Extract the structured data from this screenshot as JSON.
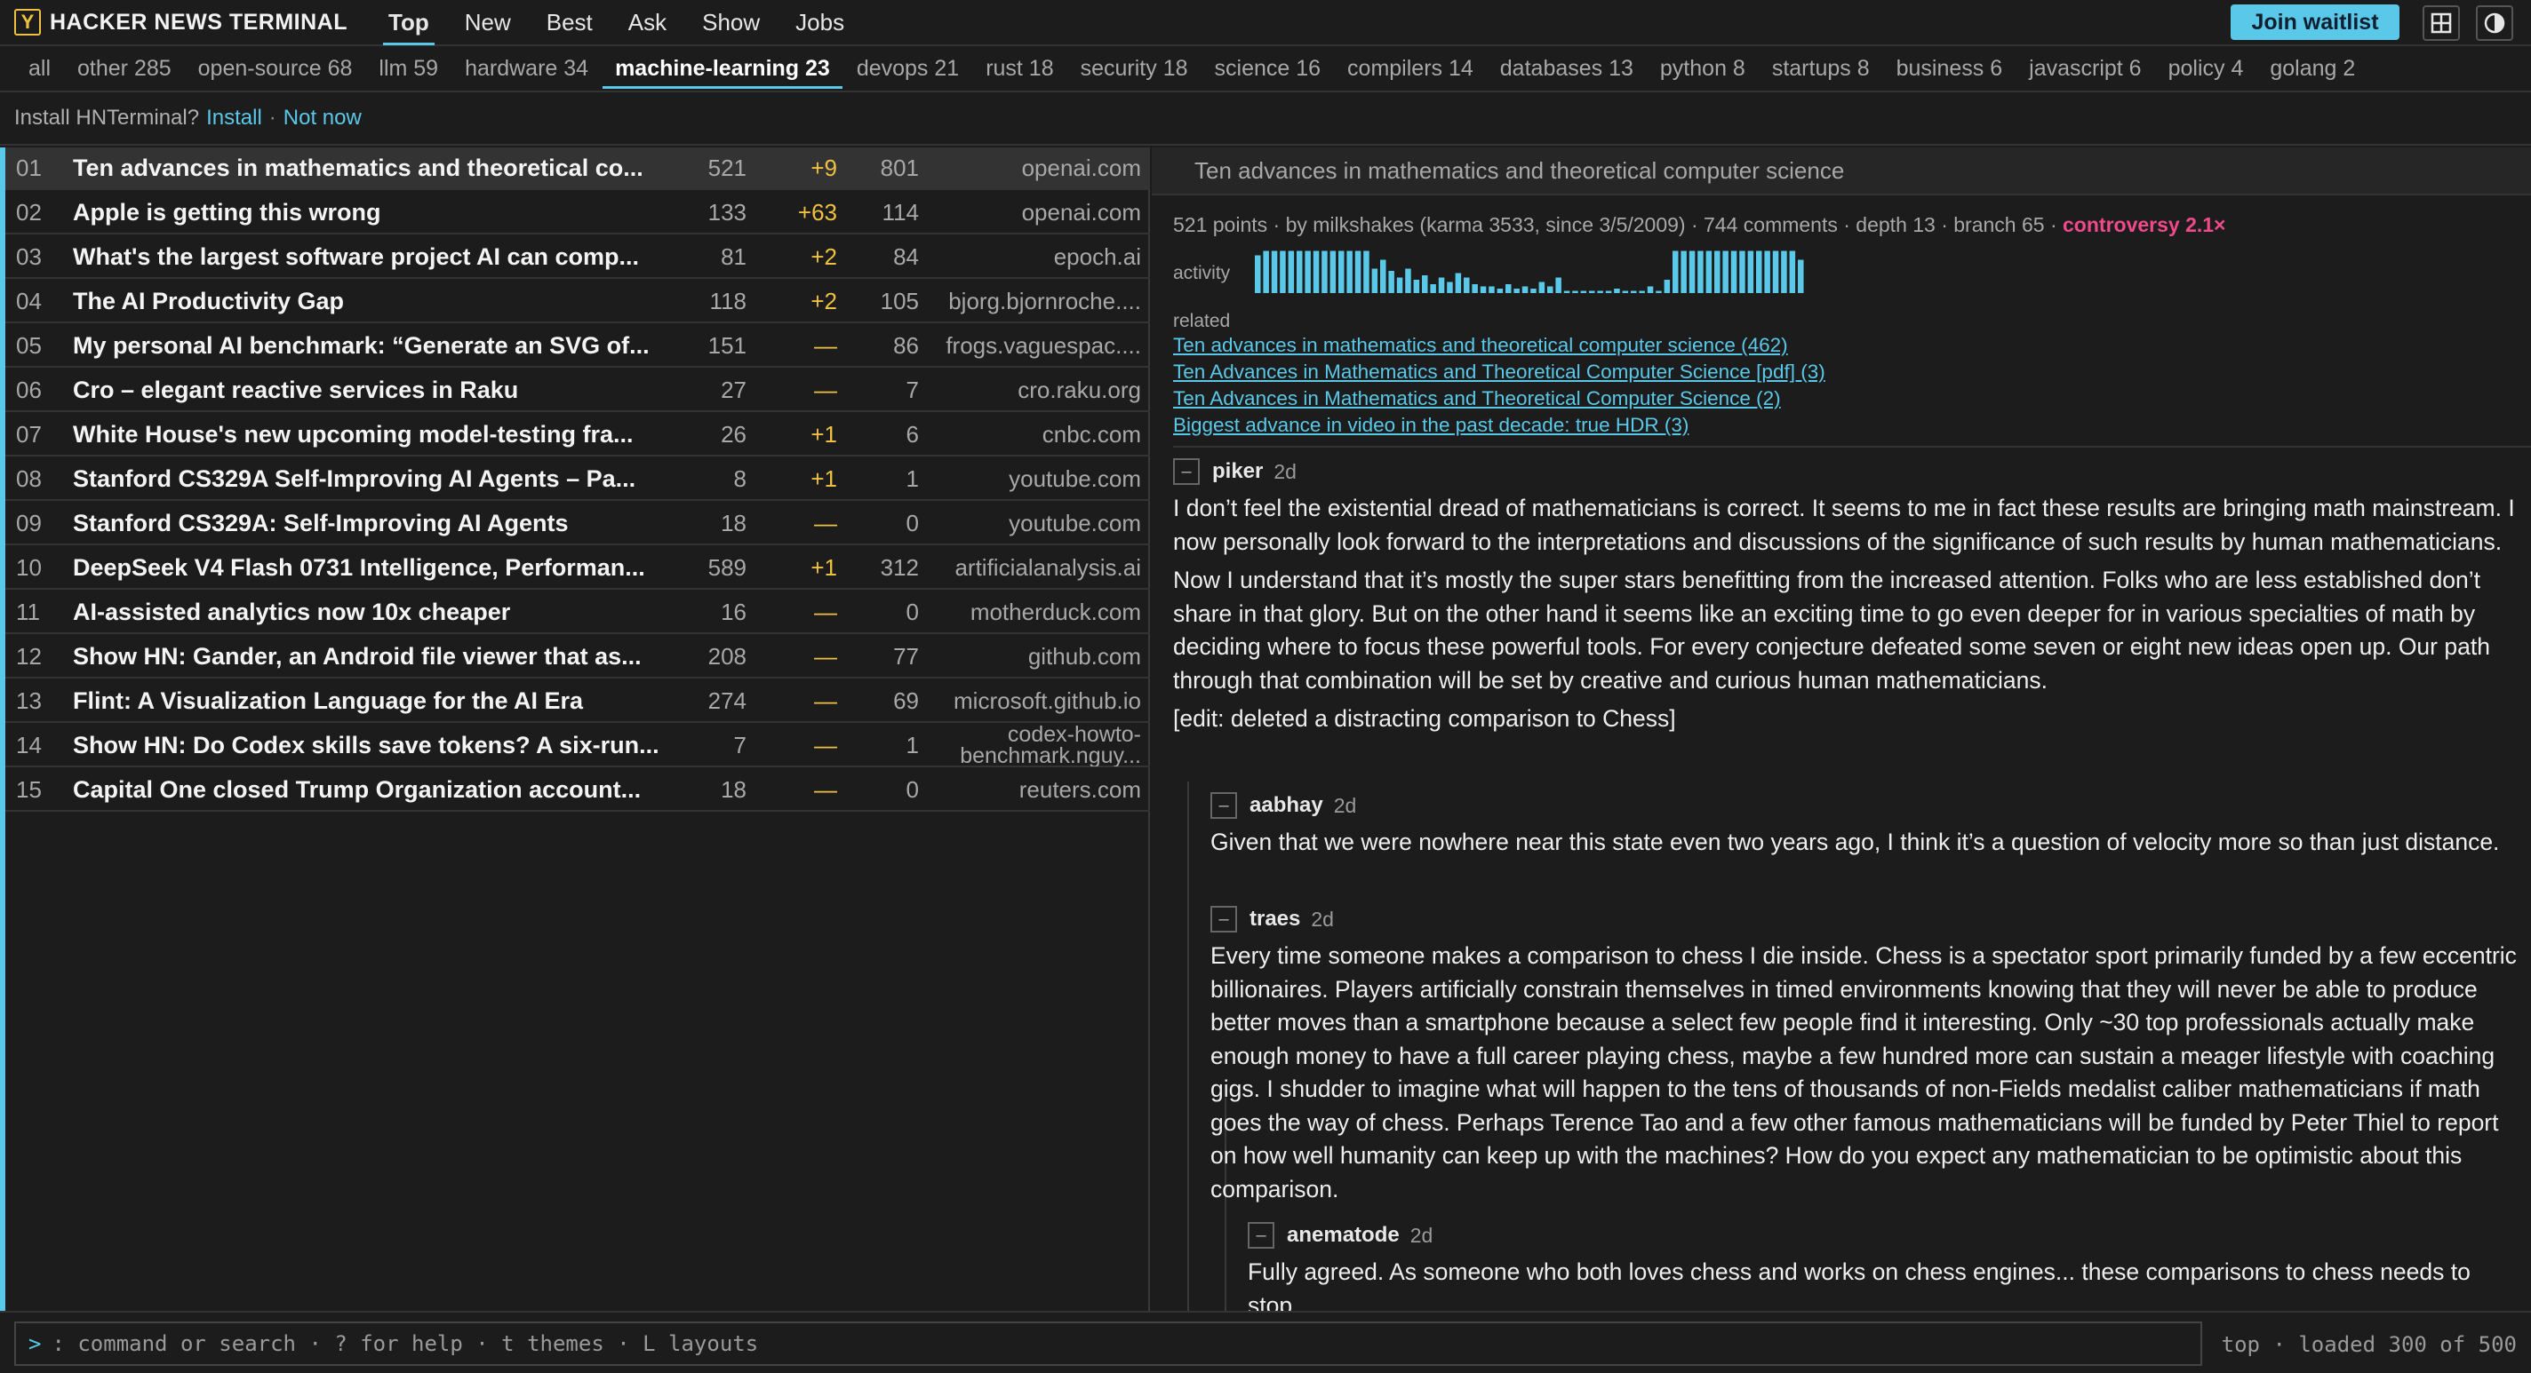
{
  "header": {
    "logo": "Y",
    "brand": "HACKER NEWS TERMINAL",
    "tabs": [
      "Top",
      "New",
      "Best",
      "Ask",
      "Show",
      "Jobs"
    ],
    "active_tab": "Top",
    "waitlist_label": "Join waitlist",
    "icons": [
      "grid-icon",
      "contrast-icon"
    ]
  },
  "categories": [
    {
      "label": "all"
    },
    {
      "label": "other 285"
    },
    {
      "label": "open-source 68"
    },
    {
      "label": "llm 59"
    },
    {
      "label": "hardware 34"
    },
    {
      "label": "machine-learning 23",
      "active": true
    },
    {
      "label": "devops 21"
    },
    {
      "label": "rust 18"
    },
    {
      "label": "security 18"
    },
    {
      "label": "science 16"
    },
    {
      "label": "compilers 14"
    },
    {
      "label": "databases 13"
    },
    {
      "label": "python 8"
    },
    {
      "label": "startups 8"
    },
    {
      "label": "business 6"
    },
    {
      "label": "javascript 6"
    },
    {
      "label": "policy 4"
    },
    {
      "label": "golang 2"
    }
  ],
  "install": {
    "prompt": "Install HNTerminal?",
    "install_label": "Install",
    "separator": "·",
    "dismiss_label": "Not now"
  },
  "stories": [
    {
      "num": "01",
      "title": "Ten advances in mathematics and theoretical co...",
      "points": "521",
      "delta": "+9",
      "comments": "801",
      "domain": "openai.com"
    },
    {
      "num": "02",
      "title": "Apple is getting this wrong",
      "points": "133",
      "delta": "+63",
      "comments": "114",
      "domain": "openai.com"
    },
    {
      "num": "03",
      "title": "What's the largest software project AI can comp...",
      "points": "81",
      "delta": "+2",
      "comments": "84",
      "domain": "epoch.ai"
    },
    {
      "num": "04",
      "title": "The AI Productivity Gap",
      "points": "118",
      "delta": "+2",
      "comments": "105",
      "domain": "bjorg.bjornroche...."
    },
    {
      "num": "05",
      "title": "My personal AI benchmark: “Generate an SVG of...",
      "points": "151",
      "delta": "—",
      "comments": "86",
      "domain": "frogs.vaguespac...."
    },
    {
      "num": "06",
      "title": "Cro – elegant reactive services in Raku",
      "points": "27",
      "delta": "—",
      "comments": "7",
      "domain": "cro.raku.org"
    },
    {
      "num": "07",
      "title": "White House's new upcoming model-testing fra...",
      "points": "26",
      "delta": "+1",
      "comments": "6",
      "domain": "cnbc.com"
    },
    {
      "num": "08",
      "title": "Stanford CS329A Self-Improving AI Agents – Pa...",
      "points": "8",
      "delta": "+1",
      "comments": "1",
      "domain": "youtube.com"
    },
    {
      "num": "09",
      "title": "Stanford CS329A: Self-Improving AI Agents",
      "points": "18",
      "delta": "—",
      "comments": "0",
      "domain": "youtube.com"
    },
    {
      "num": "10",
      "title": "DeepSeek V4 Flash 0731 Intelligence, Performan...",
      "points": "589",
      "delta": "+1",
      "comments": "312",
      "domain": "artificialanalysis.ai"
    },
    {
      "num": "11",
      "title": "AI-assisted analytics now 10x cheaper",
      "points": "16",
      "delta": "—",
      "comments": "0",
      "domain": "motherduck.com"
    },
    {
      "num": "12",
      "title": "Show HN: Gander, an Android file viewer that as...",
      "points": "208",
      "delta": "—",
      "comments": "77",
      "domain": "github.com"
    },
    {
      "num": "13",
      "title": "Flint: A Visualization Language for the AI Era",
      "points": "274",
      "delta": "—",
      "comments": "69",
      "domain": "microsoft.github.io"
    },
    {
      "num": "14",
      "title": "Show HN: Do Codex skills save tokens? A six-run...",
      "points": "7",
      "delta": "—",
      "comments": "1",
      "domain": "codex-howto-benchmark.nguy..."
    },
    {
      "num": "15",
      "title": "Capital One closed Trump Organization account...",
      "points": "18",
      "delta": "—",
      "comments": "0",
      "domain": "reuters.com"
    }
  ],
  "selected_story": 0,
  "detail": {
    "title": "Ten advances in mathematics and theoretical computer science",
    "meta": "521 points · by milkshakes (karma 3533, since 3/5/2009) · 744 comments · depth 13 · branch 65 ·",
    "controversy": "controversy 2.1×",
    "activity_label": "activity",
    "activity": [
      0.85,
      0.95,
      0.95,
      0.95,
      0.95,
      0.95,
      0.95,
      0.95,
      0.95,
      0.95,
      0.95,
      0.95,
      0.95,
      0.95,
      0.55,
      0.75,
      0.5,
      0.35,
      0.55,
      0.3,
      0.4,
      0.2,
      0.35,
      0.25,
      0.45,
      0.35,
      0.2,
      0.15,
      0.15,
      0.1,
      0.2,
      0.1,
      0.15,
      0.1,
      0.25,
      0.15,
      0.35,
      0.05,
      0.05,
      0.05,
      0.05,
      0.05,
      0.05,
      0.1,
      0.05,
      0.05,
      0.05,
      0.15,
      0.05,
      0.3,
      0.95,
      0.95,
      0.95,
      0.95,
      0.95,
      0.95,
      0.95,
      0.95,
      0.95,
      0.95,
      0.95,
      0.95,
      0.95,
      0.95,
      0.95,
      0.75
    ],
    "related_label": "related",
    "related": [
      "Ten advances in mathematics and theoretical computer science (462)",
      "Ten Advances in Mathematics and Theoretical Computer Science [pdf] (3)",
      "Ten Advances in Mathematics and Theoretical Computer Science (2)",
      "Biggest advance in video in the past decade: true HDR (3)"
    ]
  },
  "comments": [
    {
      "author": "piker",
      "age": "2d",
      "collapse": "–",
      "paragraphs": [
        "I don’t feel the existential dread of mathematicians is correct. It seems to me in fact these results are bringing math mainstream. I now personally look forward to the interpretations and discussions of the significance of such results by human mathematicians.",
        "Now I understand that it’s mostly the super stars benefitting from the increased attention. Folks who are less established don’t share in that glory. But on the other hand it seems like an exciting time to go even deeper for in various specialties of math by deciding where to focus these powerful tools. For every conjecture defeated some seven or eight new ideas open up. Our path through that combination will be set by creative and curious human mathematicians.",
        "[edit: deleted a distracting comparison to Chess]"
      ]
    },
    {
      "author": "aabhay",
      "age": "2d",
      "collapse": "–",
      "paragraphs": [
        "Given that we were nowhere near this state even two years ago, I think it’s a question of velocity more so than just distance."
      ]
    },
    {
      "author": "traes",
      "age": "2d",
      "collapse": "–",
      "paragraphs": [
        "Every time someone makes a comparison to chess I die inside. Chess is a spectator sport primarily funded by a few eccentric billionaires. Players artificially constrain themselves in timed environments knowing that they will never be able to produce better moves than a smartphone because a select few people find it interesting. Only ~30 top professionals actually make enough money to have a full career playing chess, maybe a few hundred more can sustain a meager lifestyle with coaching gigs. I shudder to imagine what will happen to the tens of thousands of non-Fields medalist caliber mathematicians if math goes the way of chess. Perhaps Terence Tao and a few other famous mathematicians will be funded by Peter Thiel to report on how well humanity can keep up with the machines? How do you expect any mathematician to be optimistic about this comparison."
      ]
    },
    {
      "author": "anematode",
      "age": "2d",
      "collapse": "–",
      "paragraphs": [
        "Fully agreed. As someone who both loves chess and works on chess engines... these comparisons to chess needs to stop."
      ]
    }
  ],
  "footer": {
    "prompt": ">",
    "placeholder": ": command or search · ? for help · t themes · L layouts",
    "status": "top · loaded 300 of 500"
  },
  "colors": {
    "accent": "#5ac8e8",
    "delta": "#f0c040",
    "controversy": "#f04a8a",
    "background": "#1c1c1c"
  }
}
